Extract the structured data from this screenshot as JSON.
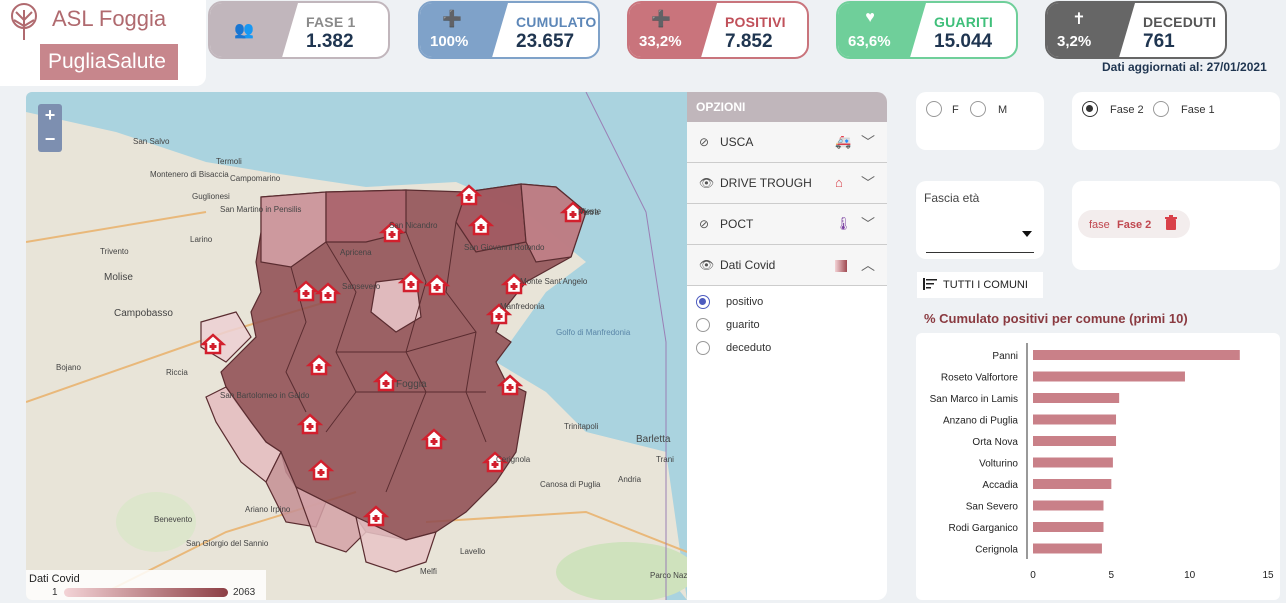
{
  "logo": {
    "line1": "ASL Foggia",
    "line2": "PugliaSalute"
  },
  "cards": [
    {
      "id": "fase1",
      "icon": "users-icon",
      "glyph": "👥",
      "pct": "",
      "label": "FASE 1",
      "value": "1.382",
      "accent": "#c1b6bc",
      "label_color": "#8a8a8a"
    },
    {
      "id": "cumulato",
      "icon": "user-plus-icon",
      "glyph": "➕",
      "pct": "100%",
      "label": "CUMULATO",
      "value": "23.657",
      "accent": "#7fa2c9",
      "label_color": "#5d87b8"
    },
    {
      "id": "positivi",
      "icon": "user-plus-icon",
      "glyph": "➕",
      "pct": "33,2%",
      "label": "POSITIVI",
      "value": "7.852",
      "accent": "#c9747c",
      "label_color": "#c0505a"
    },
    {
      "id": "guariti",
      "icon": "heart-pulse-icon",
      "glyph": "♥",
      "pct": "63,6%",
      "label": "GUARITI",
      "value": "15.044",
      "accent": "#6fcf9a",
      "label_color": "#3fbf7a"
    },
    {
      "id": "deceduti",
      "icon": "cross-icon",
      "glyph": "✝",
      "pct": "3,2%",
      "label": "DECEDUTI",
      "value": "761",
      "accent": "#666666",
      "label_color": "#555555"
    }
  ],
  "updated": "Dati aggiornati al: 27/01/2021",
  "map": {
    "zoom_in": "+",
    "zoom_out": "−",
    "place_labels": [
      {
        "t": "Vieste"
      },
      {
        "t": "San Salvo"
      },
      {
        "t": "Termoli"
      },
      {
        "t": "Campomarino"
      },
      {
        "t": "Montenero di Bisaccia"
      },
      {
        "t": "Guglionesi"
      },
      {
        "t": "San Martino in Pensilis"
      },
      {
        "t": "Larino"
      },
      {
        "t": "Trivento"
      },
      {
        "t": "Molise"
      },
      {
        "t": "Campobasso"
      },
      {
        "t": "Bojano"
      },
      {
        "t": "Riccia"
      },
      {
        "t": "San Bartolomeo in Galdo"
      },
      {
        "t": "Golfo di Manfredonia"
      },
      {
        "t": "Trinitapoli"
      },
      {
        "t": "Barletta"
      },
      {
        "t": "Trani"
      },
      {
        "t": "Andria"
      },
      {
        "t": "Canosa di Puglia"
      },
      {
        "t": "Benevento"
      },
      {
        "t": "Ariano Irpino"
      },
      {
        "t": "San Giorgio del Sannio"
      },
      {
        "t": "Lavello"
      },
      {
        "t": "Melfi"
      },
      {
        "t": "Parco Nazionale dell'Alta Murgia"
      },
      {
        "t": "Apricena"
      },
      {
        "t": "San Nicandro"
      },
      {
        "t": "Manfredonia"
      },
      {
        "t": "Foggia"
      },
      {
        "t": "Cerignola"
      },
      {
        "t": "San Giovanni Rotondo"
      },
      {
        "t": "Monte Sant'Angelo"
      },
      {
        "t": "Sansevero"
      },
      {
        "t": "Pietra"
      }
    ],
    "legend": {
      "title": "Dati Covid",
      "min": "1",
      "max": "2063"
    }
  },
  "options": {
    "header": "OPZIONI",
    "layers": [
      {
        "label": "USCA",
        "visible": false,
        "icon": "ambulance-icon",
        "glyph": "🚑",
        "expanded": false
      },
      {
        "label": "DRIVE TROUGH",
        "visible": true,
        "icon": "house-medical-icon",
        "glyph": "⌂",
        "expanded": false
      },
      {
        "label": "POCT",
        "visible": false,
        "icon": "thermometer-icon",
        "glyph": "🌡",
        "expanded": false
      },
      {
        "label": "Dati Covid",
        "visible": true,
        "icon": "gradient-swatch-icon",
        "glyph": "",
        "expanded": true
      }
    ],
    "metric_options": [
      "positivo",
      "guarito",
      "deceduto"
    ],
    "metric_selected": "positivo"
  },
  "filters": {
    "sex": [
      "F",
      "M"
    ],
    "phase": [
      "Fase 2",
      "Fase 1"
    ],
    "phase_selected": "Fase 2",
    "age_label": "Fascia età",
    "chip": {
      "key": "fase",
      "value": "Fase 2"
    },
    "all_comuni": "TUTTI I COMUNI"
  },
  "chart_data": {
    "type": "bar",
    "orientation": "horizontal",
    "title": "% Cumulato positivi per comune (primi 10)",
    "categories": [
      "Panni",
      "Roseto Valfortore",
      "San Marco in Lamis",
      "Anzano di Puglia",
      "Orta Nova",
      "Volturino",
      "Accadia",
      "San Severo",
      "Rodi Garganico",
      "Cerignola"
    ],
    "values": [
      13.2,
      9.7,
      5.5,
      5.3,
      5.3,
      5.1,
      5.0,
      4.5,
      4.5,
      4.4
    ],
    "xlim": [
      0,
      15
    ],
    "xticks": [
      "0",
      "5",
      "10",
      "15"
    ],
    "color": "#c98088"
  }
}
